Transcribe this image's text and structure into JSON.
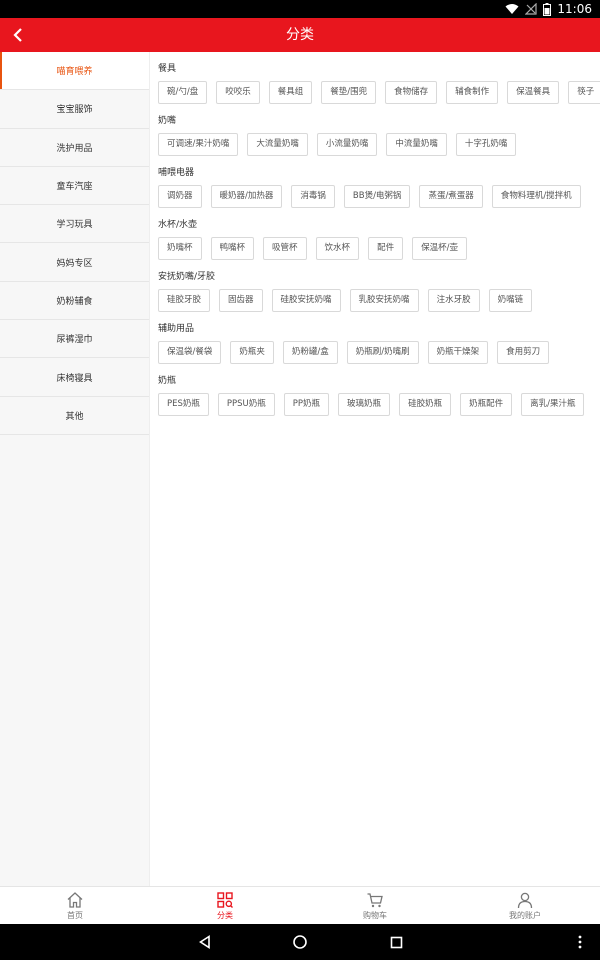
{
  "status": {
    "time": "11:06"
  },
  "header": {
    "title": "分类"
  },
  "sidebar": {
    "items": [
      {
        "label": "喵育喂养"
      },
      {
        "label": "宝宝服饰"
      },
      {
        "label": "洗护用品"
      },
      {
        "label": "童车汽座"
      },
      {
        "label": "学习玩具"
      },
      {
        "label": "妈妈专区"
      },
      {
        "label": "奶粉辅食"
      },
      {
        "label": "尿裤湿巾"
      },
      {
        "label": "床椅寝具"
      },
      {
        "label": "其他"
      }
    ]
  },
  "sections": [
    {
      "title": "餐具",
      "tags": [
        "碗/勺/盘",
        "咬咬乐",
        "餐具组",
        "餐垫/围兜",
        "食物储存",
        "辅食制作",
        "保温餐具",
        "筷子"
      ]
    },
    {
      "title": "奶嘴",
      "tags": [
        "可调速/果汁奶嘴",
        "大流量奶嘴",
        "小流量奶嘴",
        "中流量奶嘴",
        "十字孔奶嘴"
      ]
    },
    {
      "title": "哺喂电器",
      "tags": [
        "调奶器",
        "暖奶器/加热器",
        "消毒锅",
        "BB煲/电粥锅",
        "蒸蛋/煮蛋器",
        "食物料理机/搅拌机"
      ]
    },
    {
      "title": "水杯/水壶",
      "tags": [
        "奶嘴杯",
        "鸭嘴杯",
        "吸管杯",
        "饮水杯",
        "配件",
        "保温杯/壶"
      ]
    },
    {
      "title": "安抚奶嘴/牙胶",
      "tags": [
        "硅胶牙胶",
        "固齿器",
        "硅胶安抚奶嘴",
        "乳胶安抚奶嘴",
        "注水牙胶",
        "奶嘴链"
      ]
    },
    {
      "title": "辅助用品",
      "tags": [
        "保温袋/餐袋",
        "奶瓶夹",
        "奶粉罐/盒",
        "奶瓶刷/奶嘴刷",
        "奶瓶干燥架",
        "食用剪刀"
      ]
    },
    {
      "title": "奶瓶",
      "tags": [
        "PES奶瓶",
        "PPSU奶瓶",
        "PP奶瓶",
        "玻璃奶瓶",
        "硅胶奶瓶",
        "奶瓶配件",
        "离乳/果汁瓶"
      ]
    }
  ],
  "bottom_tabs": [
    {
      "label": "首页",
      "icon": "home-icon"
    },
    {
      "label": "分类",
      "icon": "category-icon"
    },
    {
      "label": "购物车",
      "icon": "cart-icon"
    },
    {
      "label": "我的账户",
      "icon": "user-icon"
    }
  ],
  "colors": {
    "brand": "#e8161e",
    "active_sidebar": "#e8530f"
  }
}
